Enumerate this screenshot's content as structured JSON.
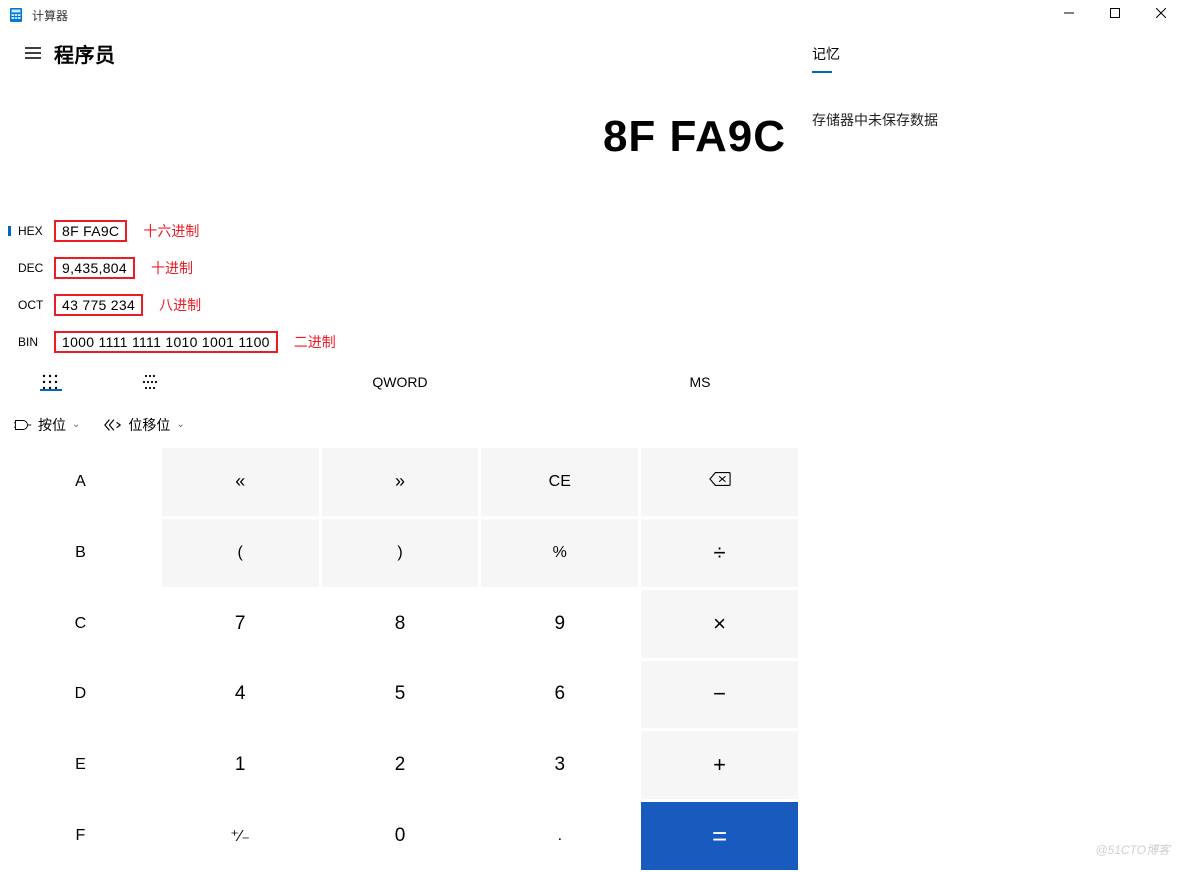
{
  "title": "计算器",
  "mode": "程序员",
  "display_value": "8F FA9C",
  "bases": {
    "hex": {
      "label": "HEX",
      "value": "8F FA9C",
      "annotation": "十六进制",
      "active": true
    },
    "dec": {
      "label": "DEC",
      "value": "9,435,804",
      "annotation": "十进制",
      "active": false
    },
    "oct": {
      "label": "OCT",
      "value": "43 775 234",
      "annotation": "八进制",
      "active": false
    },
    "bin": {
      "label": "BIN",
      "value": "1000 1111 1111 1010 1001 1100",
      "annotation": "二进制",
      "active": false
    }
  },
  "toolbar": {
    "word_size": "QWORD",
    "ms_label": "MS"
  },
  "dropdowns": {
    "bitwise": "按位",
    "bitshift": "位移位"
  },
  "keypad": {
    "r0": [
      "A",
      "«",
      "»",
      "CE",
      "⌫"
    ],
    "r1": [
      "B",
      "(",
      ")",
      "%",
      "÷"
    ],
    "r2": [
      "C",
      "7",
      "8",
      "9",
      "×"
    ],
    "r3": [
      "D",
      "4",
      "5",
      "6",
      "−"
    ],
    "r4": [
      "E",
      "1",
      "2",
      "3",
      "+"
    ],
    "r5": [
      "F",
      "⁺⁄₋",
      "0",
      ".",
      "="
    ]
  },
  "memory": {
    "tab_label": "记忆",
    "empty_text": "存储器中未保存数据"
  },
  "watermark": "@51CTO博客"
}
